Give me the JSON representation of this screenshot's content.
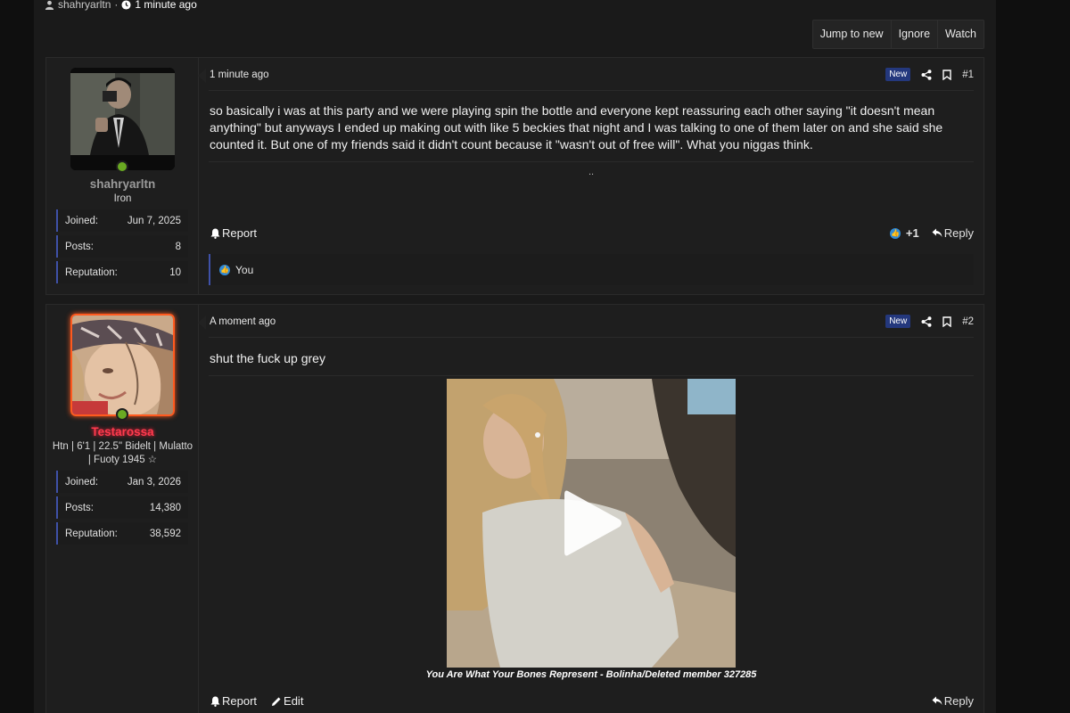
{
  "thread_meta": {
    "author": "shahryarltn",
    "separator": "·",
    "time": "1 minute ago"
  },
  "thread_buttons": {
    "jump": "Jump to new",
    "ignore": "Ignore",
    "watch": "Watch"
  },
  "posts": [
    {
      "username": "shahryarltn",
      "user_title": "Iron",
      "stats": [
        {
          "label": "Joined:",
          "value": "Jun 7, 2025"
        },
        {
          "label": "Posts:",
          "value": "8"
        },
        {
          "label": "Reputation:",
          "value": "10"
        }
      ],
      "time": "1 minute ago",
      "badge": "New",
      "number": "#1",
      "body": "so basically i was at this party and we were playing spin the bottle and everyone kept reassuring each other saying \"it doesn't mean anything\" but anyways I ended up making out with like 5 beckies that night and I was talking to one of them later on and she said she counted it. But one of my friends said it didn't count because it \"wasn't out of free will\". What you niggas think.",
      "signature": "..",
      "report": "Report",
      "reaction_count": "+1",
      "reply": "Reply",
      "reactions_by": "You"
    },
    {
      "username": "Testarossa",
      "user_title": "Htn | 6'1 | 22.5\" Bidelt | Mulatto | Fuoty 1945 ☆",
      "stats": [
        {
          "label": "Joined:",
          "value": "Jan 3, 2026"
        },
        {
          "label": "Posts:",
          "value": "14,380"
        },
        {
          "label": "Reputation:",
          "value": "38,592"
        }
      ],
      "time": "A moment ago",
      "badge": "New",
      "number": "#2",
      "body": "shut the fuck up grey",
      "caption": "You Are What Your Bones Represent - Bolinha/Deleted member 327285",
      "report": "Report",
      "edit": "Edit",
      "reply": "Reply"
    }
  ],
  "colors": {
    "accent": "#3f51a8",
    "badge_new": "#24387d",
    "online": "#6aaa22",
    "like": "#2f8ad8",
    "username_red": "#ff3b4e"
  }
}
